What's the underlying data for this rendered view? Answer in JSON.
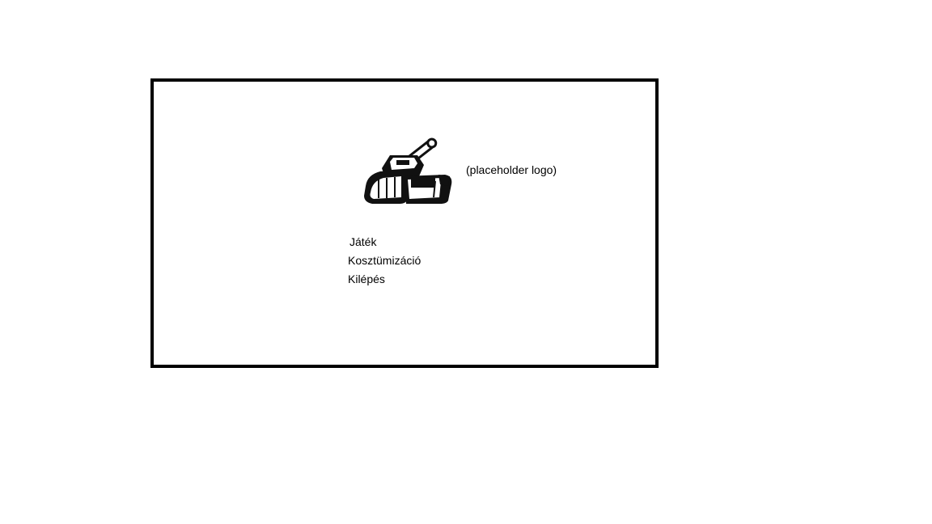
{
  "logo": {
    "icon": "tank-icon",
    "caption": "(placeholder logo)"
  },
  "menu": {
    "items": [
      {
        "label": "Játék"
      },
      {
        "label": "Kosztümizáció"
      },
      {
        "label": "Kilépés"
      }
    ]
  },
  "colors": {
    "frame": "#000000",
    "background": "#ffffff",
    "text": "#000000"
  }
}
